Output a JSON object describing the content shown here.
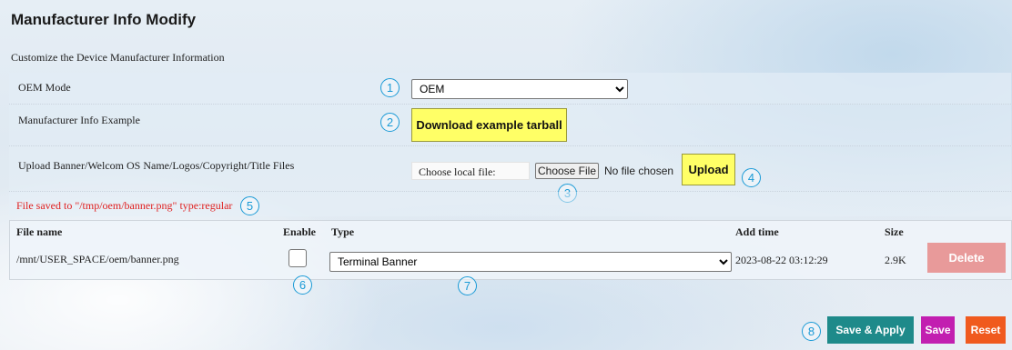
{
  "page": {
    "title": "Manufacturer Info Modify",
    "subtitle": "Customize the Device Manufacturer Information"
  },
  "oem_mode": {
    "label": "OEM Mode",
    "selected": "OEM",
    "marker": "1"
  },
  "example": {
    "label": "Manufacturer Info Example",
    "button": "Download example tarball",
    "marker": "2"
  },
  "upload": {
    "label": "Upload Banner/Welcom OS Name/Logos/Copyright/Title Files",
    "choose_local_label": "Choose local file:",
    "choose_file_button": "Choose File",
    "no_file_text": "No file chosen",
    "file_marker": "3",
    "upload_button": "Upload",
    "upload_marker": "4"
  },
  "status": {
    "text": "File saved to \"/tmp/oem/banner.png\" type:regular",
    "marker": "5",
    "color": "#e02020"
  },
  "table": {
    "headers": {
      "file_name": "File name",
      "enable": "Enable",
      "type": "Type",
      "add_time": "Add time",
      "size": "Size"
    },
    "rows": [
      {
        "file_name": "/mnt/USER_SPACE/oem/banner.png",
        "enabled": false,
        "type": "Terminal Banner",
        "add_time": "2023-08-22 03:12:29",
        "size": "2.9K",
        "delete_label": "Delete"
      }
    ],
    "enable_marker": "6",
    "type_marker": "7"
  },
  "actions": {
    "marker": "8",
    "save_apply": "Save & Apply",
    "save": "Save",
    "reset": "Reset"
  },
  "colors": {
    "marker": "#1a9ad6",
    "yellow_button": "#ffff66",
    "save_apply": "#1e8a8a",
    "save": "#c21fb0",
    "reset": "#f05a1e",
    "delete": "#e89a9a"
  }
}
